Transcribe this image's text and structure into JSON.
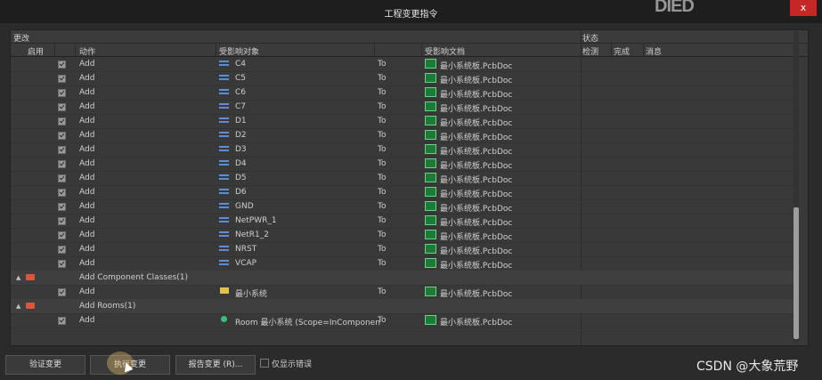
{
  "window": {
    "title": "工程变更指令",
    "close_label": "x",
    "logo_text": "DIED"
  },
  "header": {
    "section_change": "更改",
    "section_status": "状态",
    "columns": {
      "enable": "启用",
      "action": "动作",
      "affected_object": "受影响对象",
      "affected_doc": "受影响文档",
      "check": "检测",
      "done": "完成",
      "message": "消息"
    }
  },
  "rows": [
    {
      "action": "Add",
      "object": "C4",
      "to": "To",
      "doc": "最小系统板.PcbDoc"
    },
    {
      "action": "Add",
      "object": "C5",
      "to": "To",
      "doc": "最小系统板.PcbDoc"
    },
    {
      "action": "Add",
      "object": "C6",
      "to": "To",
      "doc": "最小系统板.PcbDoc"
    },
    {
      "action": "Add",
      "object": "C7",
      "to": "To",
      "doc": "最小系统板.PcbDoc"
    },
    {
      "action": "Add",
      "object": "D1",
      "to": "To",
      "doc": "最小系统板.PcbDoc"
    },
    {
      "action": "Add",
      "object": "D2",
      "to": "To",
      "doc": "最小系统板.PcbDoc"
    },
    {
      "action": "Add",
      "object": "D3",
      "to": "To",
      "doc": "最小系统板.PcbDoc"
    },
    {
      "action": "Add",
      "object": "D4",
      "to": "To",
      "doc": "最小系统板.PcbDoc"
    },
    {
      "action": "Add",
      "object": "D5",
      "to": "To",
      "doc": "最小系统板.PcbDoc"
    },
    {
      "action": "Add",
      "object": "D6",
      "to": "To",
      "doc": "最小系统板.PcbDoc"
    },
    {
      "action": "Add",
      "object": "GND",
      "to": "To",
      "doc": "最小系统板.PcbDoc"
    },
    {
      "action": "Add",
      "object": "NetPWR_1",
      "to": "To",
      "doc": "最小系统板.PcbDoc"
    },
    {
      "action": "Add",
      "object": "NetR1_2",
      "to": "To",
      "doc": "最小系统板.PcbDoc"
    },
    {
      "action": "Add",
      "object": "NRST",
      "to": "To",
      "doc": "最小系统板.PcbDoc"
    },
    {
      "action": "Add",
      "object": "VCAP",
      "to": "To",
      "doc": "最小系统板.PcbDoc"
    }
  ],
  "groups": [
    {
      "label": "Add Component Classes(1)",
      "item": {
        "action": "Add",
        "object": "最小系统",
        "to": "To",
        "doc": "最小系统板.PcbDoc"
      }
    },
    {
      "label": "Add Rooms(1)",
      "item": {
        "action": "Add",
        "object": "Room 最小系统 (Scope=InComponen",
        "to": "To",
        "doc": "最小系统板.PcbDoc"
      }
    }
  ],
  "footer": {
    "validate_button": "验证变更",
    "execute_button": "执行变更",
    "report_button": "报告变更 (R)...",
    "errors_only_label": "仅显示错误"
  },
  "watermark": "CSDN @大象荒野"
}
